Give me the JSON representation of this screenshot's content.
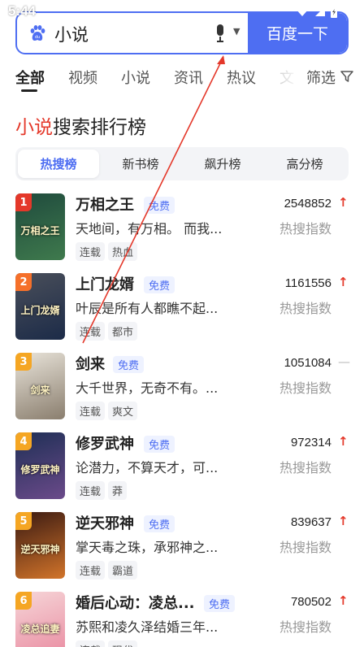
{
  "status": {
    "time": "5:44"
  },
  "search": {
    "query": "小说",
    "button": "百度一下"
  },
  "tabs": [
    "全部",
    "视频",
    "小说",
    "资讯",
    "热议",
    "文"
  ],
  "filter_label": "筛选",
  "section": {
    "title_highlight": "小说",
    "title_rest": "搜索排行榜"
  },
  "subtabs": [
    "热搜榜",
    "新书榜",
    "飙升榜",
    "高分榜"
  ],
  "books": [
    {
      "rank": "1",
      "title": "万相之王",
      "free": "免费",
      "score": "2548852",
      "trend": "↑",
      "desc": "天地间，有万相。 而我...",
      "score_label": "热搜指数",
      "tags": [
        "连载",
        "热血"
      ],
      "cover_text": "万相之王",
      "cover_colors": [
        "#1f4a3d",
        "#3f7a4d"
      ]
    },
    {
      "rank": "2",
      "title": "上门龙婿",
      "free": "免费",
      "score": "1161556",
      "trend": "↑",
      "desc": "叶辰是所有人都瞧不起...",
      "score_label": "热搜指数",
      "tags": [
        "连载",
        "都市"
      ],
      "cover_text": "上门龙婿",
      "cover_colors": [
        "#4a4f5a",
        "#1c2b48"
      ]
    },
    {
      "rank": "3",
      "title": "剑来",
      "free": "免费",
      "score": "1051084",
      "trend": "—",
      "desc": "大千世界，无奇不有。...",
      "score_label": "热搜指数",
      "tags": [
        "连载",
        "爽文"
      ],
      "cover_text": "剑来",
      "cover_colors": [
        "#e9e4da",
        "#8a7e6e"
      ]
    },
    {
      "rank": "4",
      "title": "修罗武神",
      "free": "免费",
      "score": "972314",
      "trend": "↑",
      "desc": "论潜力，不算天才，可...",
      "score_label": "热搜指数",
      "tags": [
        "连载",
        "莽"
      ],
      "cover_text": "修罗武神",
      "cover_colors": [
        "#1e2f55",
        "#6b4a8a"
      ]
    },
    {
      "rank": "5",
      "title": "逆天邪神",
      "free": "免费",
      "score": "839637",
      "trend": "↑",
      "desc": "掌天毒之珠，承邪神之...",
      "score_label": "热搜指数",
      "tags": [
        "连载",
        "霸道"
      ],
      "cover_text": "逆天邪神",
      "cover_colors": [
        "#3a1a12",
        "#d2742a"
      ]
    },
    {
      "rank": "6",
      "title": "婚后心动：凌总...",
      "free": "免费",
      "score": "780502",
      "trend": "↑",
      "desc": "苏熙和凌久泽结婚三年...",
      "score_label": "热搜指数",
      "tags": [
        "连载",
        "现代"
      ],
      "cover_text": "凌总追妻",
      "cover_colors": [
        "#f6d6d8",
        "#e98aa0"
      ]
    }
  ],
  "colors": {
    "accent": "#4e6ef2",
    "red": "#e4382a"
  }
}
